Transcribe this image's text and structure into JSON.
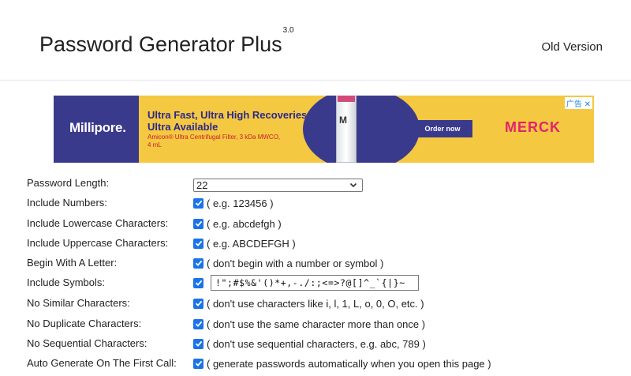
{
  "header": {
    "title": "Password Generator Plus",
    "version": "3.0",
    "old_version_link": "Old Version"
  },
  "ad": {
    "brand_left": "Millipore.",
    "headline": "Ultra Fast, Ultra High Recoveries, Ultra Available",
    "subline": "Amicon® Ultra Centrifugal Filter, 3 kDa MWCO, 4 mL",
    "tube_label": "M",
    "cta": "Order now",
    "brand_right": "MERCK",
    "badge": "广告 ✕"
  },
  "form": {
    "password_length": {
      "label": "Password Length:",
      "value": "22"
    },
    "include_numbers": {
      "label": "Include Numbers:",
      "checked": true,
      "hint": "( e.g. 123456 )"
    },
    "include_lowercase": {
      "label": "Include Lowercase Characters:",
      "checked": true,
      "hint": "( e.g. abcdefgh )"
    },
    "include_uppercase": {
      "label": "Include Uppercase Characters:",
      "checked": true,
      "hint": "( e.g. ABCDEFGH )"
    },
    "begin_with_letter": {
      "label": "Begin With A Letter:",
      "checked": true,
      "hint": "( don't begin with a number or symbol )"
    },
    "include_symbols": {
      "label": "Include Symbols:",
      "checked": true,
      "value": "!\";#$%&'()*+,-./:;<=>?@[]^_`{|}~"
    },
    "no_similar": {
      "label": "No Similar Characters:",
      "checked": true,
      "hint": "( don't use characters like i, l, 1, L, o, 0, O, etc. )"
    },
    "no_duplicate": {
      "label": "No Duplicate Characters:",
      "checked": true,
      "hint": "( don't use the same character more than once )"
    },
    "no_sequential": {
      "label": "No Sequential Characters:",
      "checked": true,
      "hint": "( don't use sequential characters, e.g. abc, 789 )"
    },
    "auto_generate": {
      "label": "Auto Generate On The First Call:",
      "checked": true,
      "hint": "( generate passwords automatically when you open this page )"
    }
  },
  "colors": {
    "checkbox": "#1a73e8",
    "ad_background": "#f5c842",
    "ad_navy": "#3a3a8c",
    "merck_pink": "#e1236f"
  }
}
